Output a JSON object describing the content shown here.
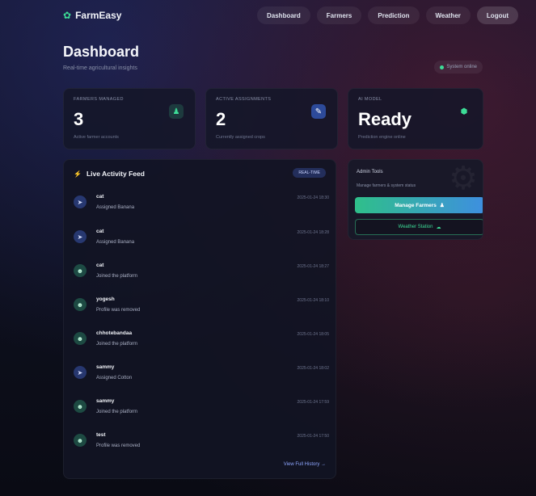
{
  "colors": {
    "accent_green": "#3ddc97",
    "accent_blue": "#4f7cff",
    "background": "#0b0d18"
  },
  "navbar": {
    "brand": "FarmEasy",
    "brand_icon": "sprout-icon",
    "links": [
      "Dashboard",
      "Farmers",
      "Prediction",
      "Weather"
    ],
    "logout": "Logout"
  },
  "header": {
    "title": "Dashboard",
    "subtitle": "Real-time agricultural insights",
    "status": "System online"
  },
  "stats": [
    {
      "label": "FARMERS MANAGED",
      "value": "3",
      "footer": "Active farmer accounts",
      "icon": "farmer-icon"
    },
    {
      "label": "ACTIVE ASSIGNMENTS",
      "value": "2",
      "footer": "Currently assigned crops",
      "icon": "pencil-icon"
    },
    {
      "label": "AI MODEL",
      "value": "Ready",
      "footer": "Prediction engine online",
      "icon": "gem-icon"
    }
  ],
  "activity": {
    "title": "Live Activity Feed",
    "badge": "REAL-TIME",
    "items": [
      {
        "name": "cat",
        "desc": "Assigned Banana",
        "time": "2025-01-24 18:30",
        "type": "assign"
      },
      {
        "name": "cat",
        "desc": "Assigned Banana",
        "time": "2025-01-24 18:28",
        "type": "assign"
      },
      {
        "name": "cat",
        "desc": "Joined the platform",
        "time": "2025-01-24 18:27",
        "type": "user"
      },
      {
        "name": "yogesh",
        "desc": "Profile was removed",
        "time": "2025-01-24 18:10",
        "type": "user"
      },
      {
        "name": "chhotebandaa",
        "desc": "Joined the platform",
        "time": "2025-01-24 18:05",
        "type": "user"
      },
      {
        "name": "sammy",
        "desc": "Assigned Cotton",
        "time": "2025-01-24 18:02",
        "type": "assign"
      },
      {
        "name": "sammy",
        "desc": "Joined the platform",
        "time": "2025-01-24 17:59",
        "type": "user"
      },
      {
        "name": "test",
        "desc": "Profile was removed",
        "time": "2025-01-24 17:50",
        "type": "user"
      }
    ],
    "view_history": "View Full History →"
  },
  "admin": {
    "title": "Admin Tools",
    "subtitle": "Manage farmers & system status",
    "manage_button": "Manage Farmers",
    "weather_button": "Weather Station"
  }
}
